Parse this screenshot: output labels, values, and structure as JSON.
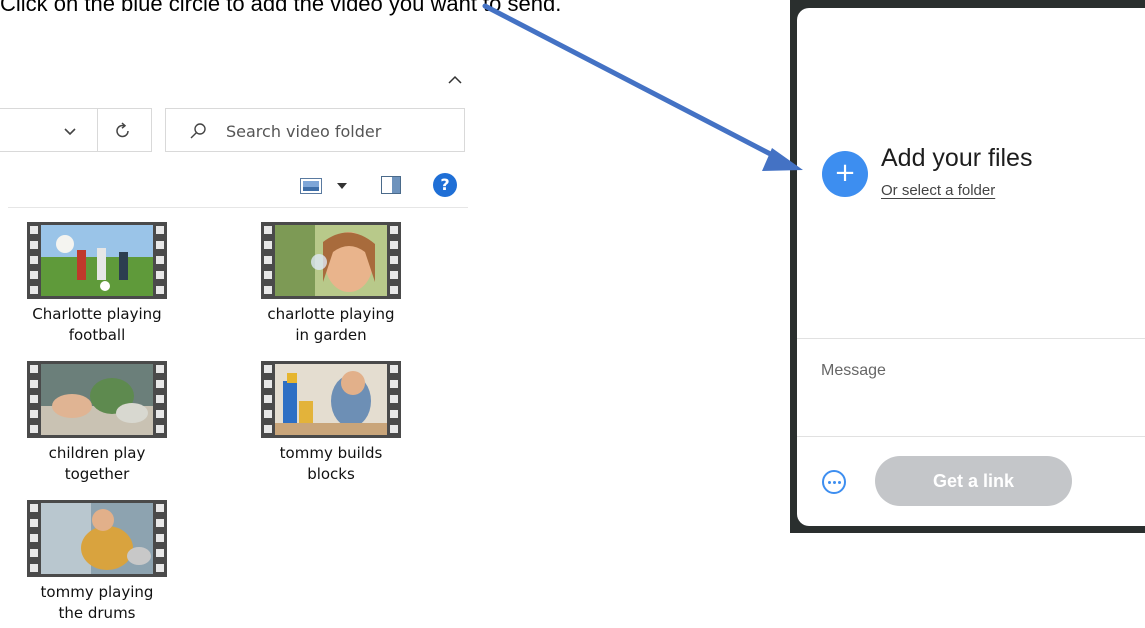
{
  "instruction": "Click on the blue circle to add the video you want to send.",
  "explorer": {
    "search_placeholder": "Search video folder",
    "help_label": "?",
    "files": [
      {
        "line1": "Charlotte playing",
        "line2": "football"
      },
      {
        "line1": "charlotte playing",
        "line2": "in garden"
      },
      {
        "line1": "children play",
        "line2": "together"
      },
      {
        "line1": "tommy builds",
        "line2": "blocks"
      },
      {
        "line1": "tommy playing",
        "line2": "the drums"
      }
    ]
  },
  "transfer": {
    "add_icon": "+",
    "add_title": "Add your files",
    "select_folder": "Or select a folder",
    "message_placeholder": "Message",
    "link_button": "Get a link"
  },
  "colors": {
    "accent": "#3d8ef0",
    "arrow": "#4472c4",
    "button_disabled": "#c4c6c9"
  },
  "icons": [
    "chevron-up-icon",
    "chevron-down-icon",
    "refresh-icon",
    "search-icon",
    "view-options-icon",
    "preview-pane-icon",
    "help-icon",
    "plus-icon",
    "more-options-icon"
  ]
}
